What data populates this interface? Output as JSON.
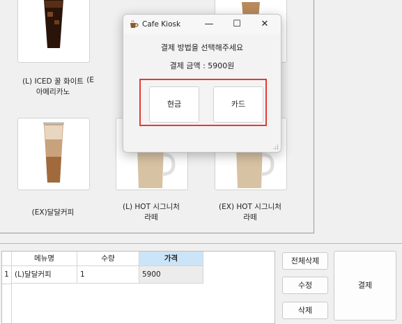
{
  "menu": {
    "items": [
      {
        "label": "(L) ICED 꿀 화이트\n아메리카노",
        "drink": "iced-americano"
      },
      {
        "label": "(E",
        "drink": "partial"
      },
      {
        "label": "",
        "drink": "partial"
      },
      {
        "label": "(EX)달달커피",
        "drink": "iced-latte"
      },
      {
        "label": "(L) HOT 시그니처\n라떼",
        "drink": "hot-latte"
      },
      {
        "label": "(EX) HOT 시그니처\n라떼",
        "drink": "hot-latte"
      }
    ]
  },
  "cart": {
    "headers": [
      "메뉴명",
      "수량",
      "가격"
    ],
    "rows": [
      {
        "index": "1",
        "name": "(L)달달커피",
        "qty": "1",
        "price": "5900"
      }
    ]
  },
  "buttons": {
    "clear_all": "전체삭제",
    "edit": "수정",
    "delete": "삭제",
    "pay": "결제"
  },
  "dialog": {
    "title": "Cafe Kiosk",
    "prompt": "결제 방법을 선택해주세요",
    "amount": "결제 금액 : 5900원",
    "cash": "현금",
    "card": "카드",
    "minimize": "—",
    "maximize": "☐",
    "close": "✕"
  }
}
